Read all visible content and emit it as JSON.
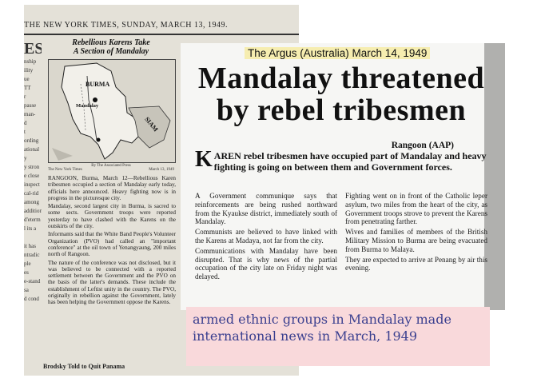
{
  "nyt": {
    "masthead": "THE NEW YORK TIMES, SUNDAY, MARCH 13, 1949.",
    "left_column": [
      "ESS",
      "nship",
      "ility",
      "ue",
      "TT",
      "r",
      "passe",
      "man-",
      "d",
      "t",
      "ording",
      "ational",
      "y",
      "y stron",
      "e close",
      "inspect",
      "cal-rid",
      "among",
      "addition",
      "d'eterm",
      "l its a",
      "",
      "it has",
      "ntradic",
      "ple",
      "es",
      "e-stand",
      "sa",
      "d cond"
    ],
    "map_headline_1": "Rebellious Karens Take",
    "map_headline_2": "A Section of Mandalay",
    "map_labels": {
      "burma": "BURMA",
      "mandalay": "Mandalay",
      "siam": "SIAM"
    },
    "map_credit": "By The Associated Press",
    "map_caption_left": "The New York Times",
    "map_caption_right": "March 13, 1949",
    "paragraphs": [
      "RANGOON, Burma, March 12—Rebellious Karen tribesmen occupied a section of Mandalay early today, officials here announced. Heavy fighting now is in progress in the picturesque city.",
      "Mandalay, second largest city in Burma, is sacred to some sects. Government troops were reported yesterday to have clashed with the Karens on the outskirts of the city.",
      "Informants said that the White Band People's Volunteer Organization (PVO) had called an \"important conference\" at the oil town of Yenangyaung, 200 miles north of Rangoon.",
      "The nature of the conference was not disclosed, but it was believed to be connected with a reported settlement between the Government and the PVO on the basis of the latter's demands. These include the establishment of Leftist unity in the country. The PVO, originally in rebellion against the Government, lately has been helping the Government oppose the Karens."
    ],
    "bottom_headline": "Brodsky Told to Quit Panama"
  },
  "argus": {
    "source_label": "The Argus (Australia) March 14, 1949",
    "headline_line1": "Mandalay threatened",
    "headline_line2": "by rebel tribesmen",
    "dateline": "Rangoon (AAP)",
    "lead_dropcap": "K",
    "lead_text": "AREN rebel tribesmen have occupied part of Mandalay and heavy fighting is going on between them and Government forces.",
    "col1": [
      "A Government communique says that reinforcements are being rushed northward from the Kyaukse district, immediately south of Mandalay.",
      "Communists are believed to have linked with the Karens at Madaya, not far from the city.",
      "Communications with Mandalay have been disrupted. That is why news of the partial occupation of the city late on Friday night was delayed."
    ],
    "col2": [
      "Fighting went on in front of the Catholic leper asylum, two miles from the heart of the city, as Government troops strove to prevent the Karens from penetrating farther.",
      "Wives and families of members of the British Military Mission to Burma are being evacuated from Burma to Malaya.",
      "They are expected to arrive at Penang by air this evening."
    ]
  },
  "caption": {
    "text": "armed ethnic groups in Mandalay made international news in March, 1949"
  }
}
